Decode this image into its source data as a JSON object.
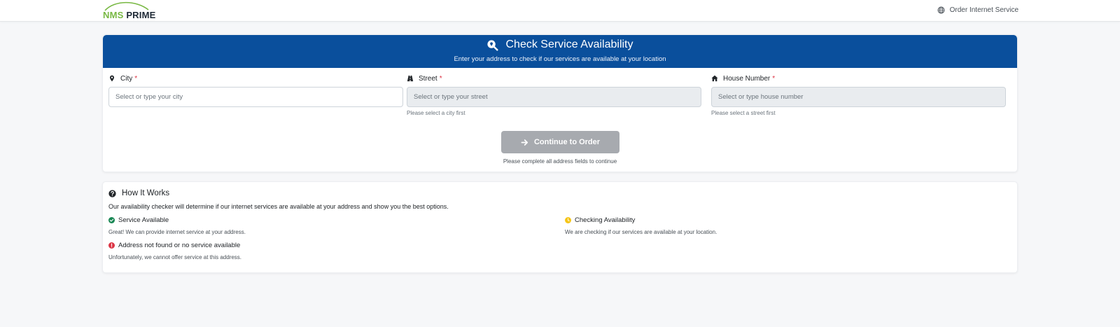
{
  "navbar": {
    "logo": {
      "nms": "NMS",
      "prime": "PRIME"
    },
    "order_link": "Order Internet Service"
  },
  "check": {
    "title": "Check Service Availability",
    "subtitle": "Enter your address to check if our services are available at your location",
    "header_color": "#0a4f9c",
    "fields": {
      "city": {
        "label": "City",
        "required": "*",
        "placeholder": "Select or type your city",
        "help": ""
      },
      "street": {
        "label": "Street",
        "required": "*",
        "placeholder": "Select or type your street",
        "help": "Please select a city first"
      },
      "house": {
        "label": "House Number",
        "required": "*",
        "placeholder": "Select or type house number",
        "help": "Please select a street first"
      }
    },
    "continue_label": "Continue to Order",
    "continue_help": "Please complete all address fields to continue"
  },
  "how": {
    "title": "How It Works",
    "description": "Our availability checker will determine if our internet services are available at your address and show you the best options.",
    "statuses": {
      "available": {
        "label": "Service Available",
        "desc": "Great! We can provide internet service at your address.",
        "color": "#198754"
      },
      "checking": {
        "label": "Checking Availability",
        "desc": "We are checking if our services are available at your location.",
        "color": "#f5c518"
      },
      "unavailable": {
        "label": "Address not found or no service available",
        "desc": "Unfortunately, we cannot offer service at this address.",
        "color": "#dc3545"
      }
    }
  },
  "icons": {
    "navbar_globe": "globe-icon",
    "header": "search-location-icon",
    "city": "map-pin-icon",
    "street": "road-icon",
    "house": "home-icon",
    "continue": "arrow-right-icon",
    "how": "question-circle-icon"
  }
}
